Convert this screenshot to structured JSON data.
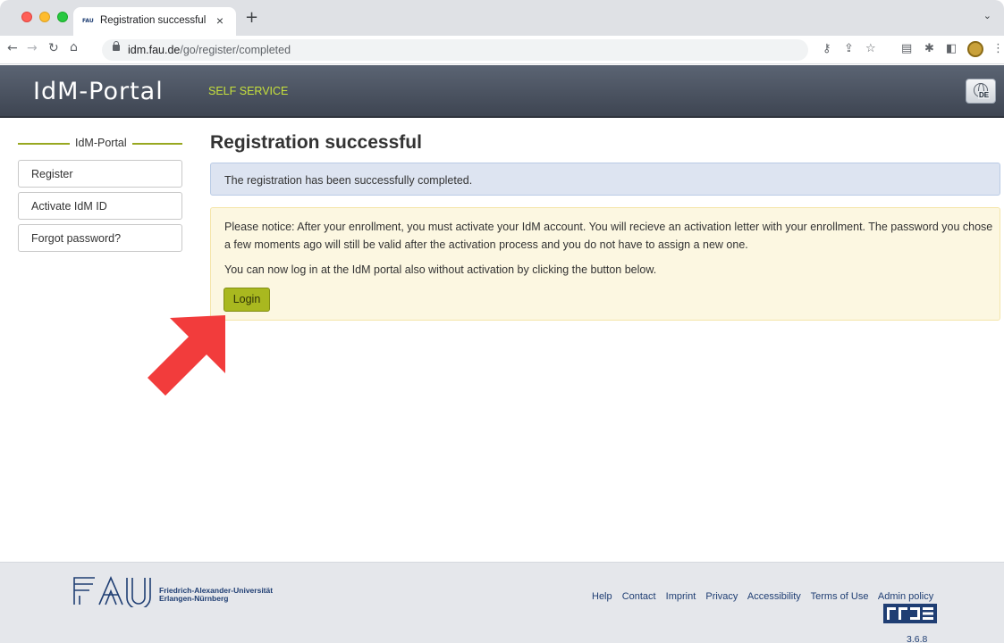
{
  "browser": {
    "tab_favicon": "FAU",
    "tab_title": "Registration successful",
    "tab_close": "×",
    "new_tab": "+",
    "tab_menu": "⌄",
    "url_domain": "idm.fau.de",
    "url_path": "/go/register/completed",
    "icons": [
      "back-icon",
      "forward-icon",
      "reload-icon",
      "home-icon",
      "lock-icon",
      "key-icon",
      "share-icon",
      "bookmark-star-icon",
      "reader-icon",
      "extensions-icon",
      "sidepanel-icon",
      "profile-icon",
      "menu-icon"
    ]
  },
  "header": {
    "brand": "IdM-Portal",
    "section": "SELF SERVICE",
    "language_label": "DE"
  },
  "sidebar": {
    "title": "IdM-Portal",
    "items": [
      {
        "label": "Register"
      },
      {
        "label": "Activate IdM ID"
      },
      {
        "label": "Forgot password?"
      }
    ]
  },
  "main": {
    "title": "Registration successful",
    "info_message": "The registration has been successfully completed.",
    "notice_text": "Please notice: After your enrollment, you must activate your IdM account. You will recieve an activation letter with your enrollment. The password you chose a few moments ago will still be valid after the activation process and you do not have to assign a new one.",
    "login_hint": "You can now log in at the IdM portal also without activation by clicking the button below.",
    "login_button": "Login"
  },
  "footer": {
    "university_line1": "Friedrich-Alexander-Universität",
    "university_line2": "Erlangen-Nürnberg",
    "links": [
      "Help",
      "Contact",
      "Imprint",
      "Privacy",
      "Accessibility",
      "Terms of Use",
      "Admin policy"
    ],
    "version": "3.6.8"
  },
  "colors": {
    "accent_green": "#a9b81f",
    "header_dark": "#3e4552",
    "info_bg": "#dde4f1",
    "warn_bg": "#fcf7e1",
    "arrow_red": "#f23c3c",
    "footer_link": "#1f3e73"
  }
}
